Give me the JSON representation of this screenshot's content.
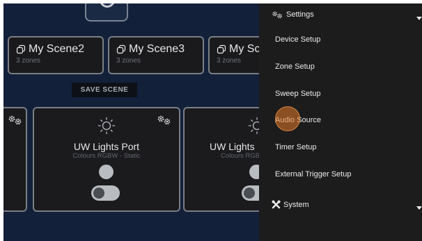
{
  "scenes": [
    {
      "name": "My Scene2",
      "sub": "3 zones"
    },
    {
      "name": "My Scene3",
      "sub": "3 zones"
    },
    {
      "name": "My Sc",
      "sub": "3 zones"
    }
  ],
  "save_scene_label": "SAVE SCENE",
  "zones": [
    {
      "title": "UW Lights Port",
      "sub": "Colours RGBW - Static"
    },
    {
      "title": "UW Lights",
      "sub": "Colours RGB"
    }
  ],
  "menu": {
    "settings_label": "Settings",
    "items": [
      "Device Setup",
      "Zone Setup",
      "Sweep Setup",
      "Audio Source",
      "Timer Setup",
      "External Trigger Setup"
    ],
    "system_label": "System"
  },
  "colors": {
    "background": "#13203a",
    "menu": "#1c1c1d",
    "card_border": "#7b7f86",
    "highlight": "#e67a28"
  }
}
